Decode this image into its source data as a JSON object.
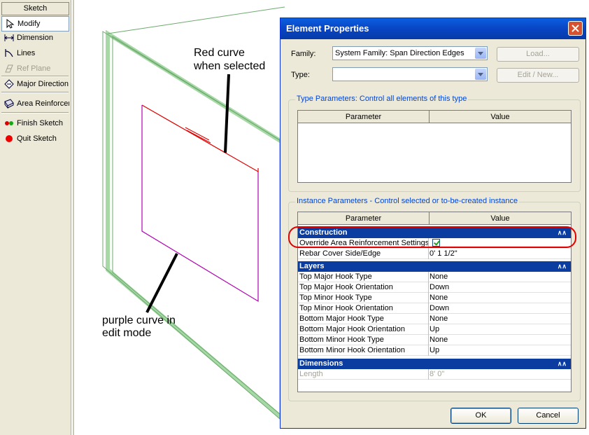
{
  "sketch_panel": {
    "header": "Sketch",
    "tools": [
      {
        "label": "Modify",
        "icon": "cursor-arrow-icon",
        "state": "active"
      },
      {
        "label": "Dimension",
        "icon": "dimension-icon",
        "state": "normal"
      },
      {
        "label": "Lines",
        "icon": "lines-icon",
        "state": "normal"
      },
      {
        "label": "Ref Plane",
        "icon": "ref-plane-icon",
        "state": "disabled"
      },
      {
        "label": "Major Direction",
        "icon": "major-direction-icon",
        "state": "normal"
      },
      {
        "label": "Area Reinforcement",
        "icon": "area-reinforcement-icon",
        "state": "normal"
      },
      {
        "label": "Finish Sketch",
        "icon": "finish-sketch-icon",
        "state": "normal"
      },
      {
        "label": "Quit Sketch",
        "icon": "quit-sketch-icon",
        "state": "normal"
      }
    ]
  },
  "annotations": {
    "red_line1": "Red curve",
    "red_line2": "when selected",
    "purple_line1": "purple curve in",
    "purple_line2": "edit mode"
  },
  "dialog": {
    "title": "Element Properties",
    "family_label": "Family:",
    "family_value": "System Family: Span Direction Edges",
    "type_label": "Type:",
    "type_value": "",
    "load_button": "Load...",
    "edit_new_button": "Edit / New...",
    "type_params_title": "Type Parameters: Control all elements of this type",
    "instance_params_title": "Instance Parameters - Control selected or to-be-created instance",
    "col_parameter": "Parameter",
    "col_value": "Value",
    "sections": {
      "construction": "Construction",
      "layers": "Layers",
      "dimensions": "Dimensions"
    },
    "construction_rows": [
      {
        "name": "Override Area Reinforcement Settings",
        "value": ""
      },
      {
        "name": "Rebar Cover Side/Edge",
        "value": "0'  1 1/2\""
      }
    ],
    "layer_rows": [
      {
        "name": "Top Major Hook Type",
        "value": "None"
      },
      {
        "name": "Top Major Hook Orientation",
        "value": "Down"
      },
      {
        "name": "Top Minor Hook Type",
        "value": "None"
      },
      {
        "name": "Top Minor Hook Orientation",
        "value": "Down"
      },
      {
        "name": "Bottom Major Hook Type",
        "value": "None"
      },
      {
        "name": "Bottom Major Hook Orientation",
        "value": "Up"
      },
      {
        "name": "Bottom Minor Hook Type",
        "value": "None"
      },
      {
        "name": "Bottom Minor Hook Orientation",
        "value": "Up"
      }
    ],
    "dimension_rows": [
      {
        "name": "Length",
        "value": "8'  0\""
      }
    ],
    "override_checked": true,
    "ok_button": "OK",
    "cancel_button": "Cancel"
  },
  "colors": {
    "selected_curve": "#e00000",
    "edit_curve": "#b000b0",
    "wall": "#9fd49f",
    "title_bar": "#0845c4",
    "section_header": "#0a3d9f"
  }
}
